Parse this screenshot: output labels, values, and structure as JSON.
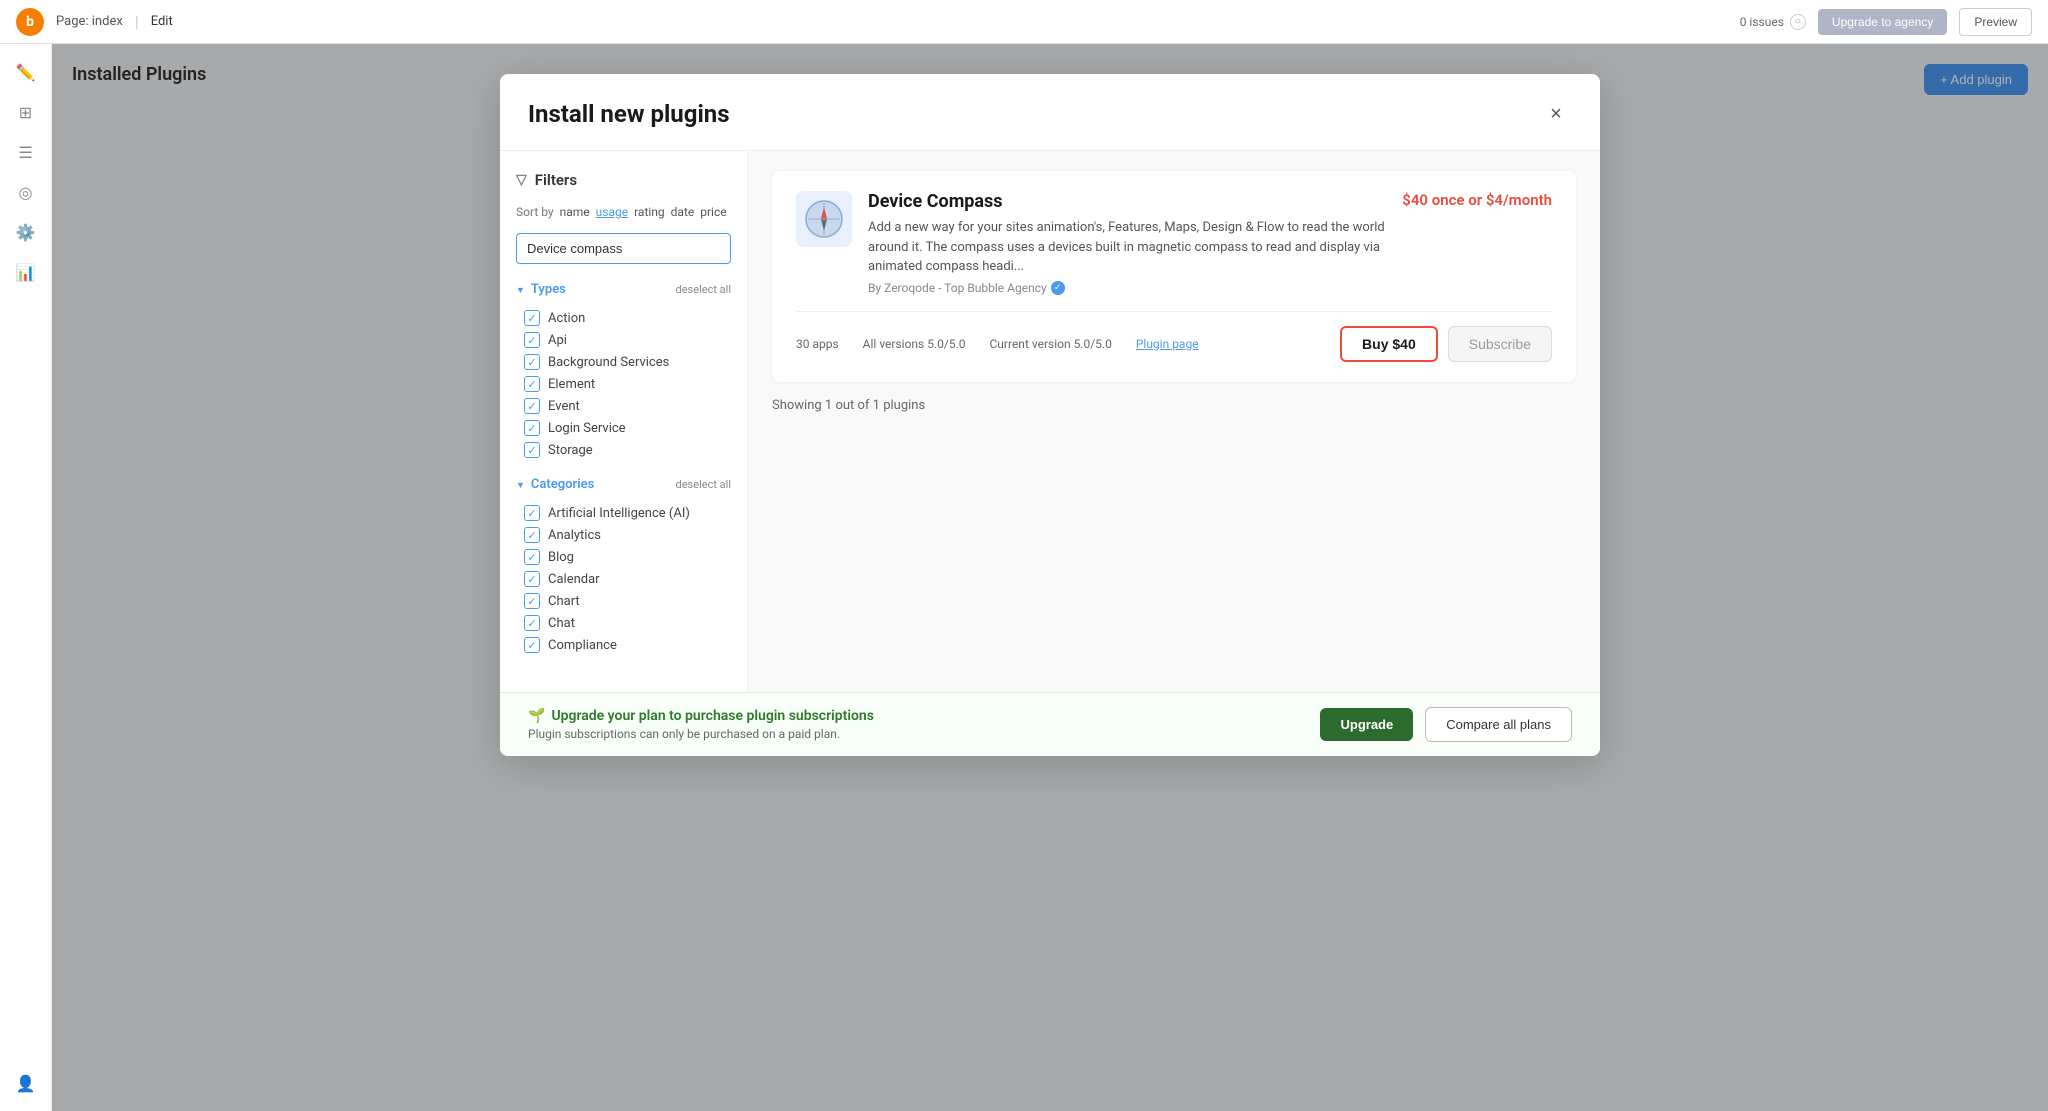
{
  "topBar": {
    "logo": "b",
    "page": "Page: index",
    "edit": "Edit",
    "issues": "0 issues",
    "upgradeLabel": "Upgrade to agency",
    "previewLabel": "Preview"
  },
  "sidebar": {
    "icons": [
      "✏️",
      "⬛",
      "☰",
      "◎",
      "⚙️",
      "📊",
      "👤"
    ]
  },
  "installedPlugins": {
    "title": "Installed Plugins",
    "addPluginLabel": "+ Add plugin"
  },
  "modal": {
    "title": "Install new plugins",
    "closeLabel": "×",
    "filters": {
      "header": "Filters",
      "sortBy": "Sort by",
      "sortOptions": [
        "name",
        "usage",
        "rating",
        "date",
        "price"
      ],
      "activeSortOption": "usage",
      "searchValue": "Device compass",
      "searchPlaceholder": "Device compass",
      "types": {
        "title": "Types",
        "deselect": "deselect all",
        "items": [
          "Action",
          "Api",
          "Background Services",
          "Element",
          "Event",
          "Login Service",
          "Storage"
        ]
      },
      "categories": {
        "title": "Categories",
        "deselect": "deselect all",
        "items": [
          "Artificial Intelligence (AI)",
          "Analytics",
          "Blog",
          "Calendar",
          "Chart",
          "Chat",
          "Compliance"
        ]
      }
    },
    "pluginCount": "Showing 1 out of 1 plugins",
    "plugin": {
      "name": "Device Compass",
      "price": "$40 once or $4/month",
      "description": "Add a new way for your sites animation's, Features, Maps, Design & Flow to read the world around it. The compass uses a devices built in magnetic compass to read and display via animated compass headi...",
      "author": "By Zeroqode - Top Bubble Agency",
      "appsCount": "30 apps",
      "allVersions": "All versions 5.0/5.0",
      "currentVersion": "Current version 5.0/5.0",
      "pluginPage": "Plugin page",
      "buyLabel": "Buy $40",
      "subscribeLabel": "Subscribe"
    }
  },
  "upgradeBar": {
    "icon": "🌱",
    "title": "Upgrade your plan to purchase plugin subscriptions",
    "subtitle": "Plugin subscriptions can only be purchased on a paid plan.",
    "upgradeLabel": "Upgrade",
    "compareLabel": "Compare all plans"
  }
}
